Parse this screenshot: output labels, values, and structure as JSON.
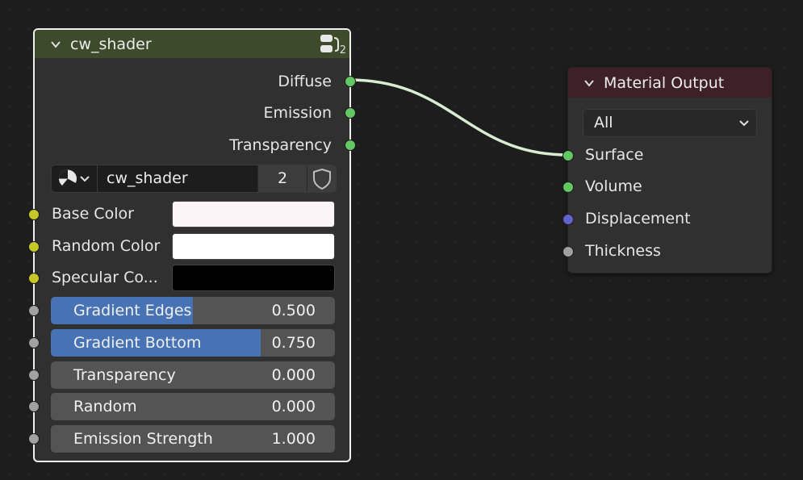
{
  "group_node": {
    "title": "cw_shader",
    "user_count": "2",
    "outputs": [
      {
        "label": "Diffuse",
        "socket": "shader-socket"
      },
      {
        "label": "Emission",
        "socket": "shader-socket"
      },
      {
        "label": "Transparency",
        "socket": "shader-socket"
      }
    ],
    "datablock": {
      "icon": "node-tree-icon",
      "name": "cw_shader",
      "users": "2",
      "fake_user_icon": "shield-icon"
    },
    "color_inputs": [
      {
        "label": "Base Color",
        "color": "#fcf5f8"
      },
      {
        "label": "Random Color",
        "color": "#ffffff"
      },
      {
        "label": "Specular Co...",
        "color": "#000000"
      }
    ],
    "value_inputs": [
      {
        "label": "Gradient Edges",
        "value": "0.500",
        "fraction": 0.5
      },
      {
        "label": "Gradient Bottom",
        "value": "0.750",
        "fraction": 0.75
      },
      {
        "label": "Transparency",
        "value": "0.000",
        "fraction": 0.0
      },
      {
        "label": "Random",
        "value": "0.000",
        "fraction": 0.0
      },
      {
        "label": "Emission Strength",
        "value": "1.000",
        "fraction": 0.0
      }
    ]
  },
  "output_node": {
    "title": "Material Output",
    "target": "All",
    "inputs": [
      {
        "label": "Surface",
        "socket": "shader-socket"
      },
      {
        "label": "Volume",
        "socket": "shader-socket"
      },
      {
        "label": "Displacement",
        "socket": "vector-socket"
      },
      {
        "label": "Thickness",
        "socket": "float-socket"
      }
    ]
  },
  "colors": {
    "shader_socket": "#63c763",
    "color_socket": "#c7c729",
    "float_socket": "#a1a1a1",
    "vector_socket": "#6363c7",
    "link": "#d7ecd0",
    "slider_fill": "#4772b3",
    "group_header": "#3e4a2c",
    "output_header": "#3d2126"
  }
}
